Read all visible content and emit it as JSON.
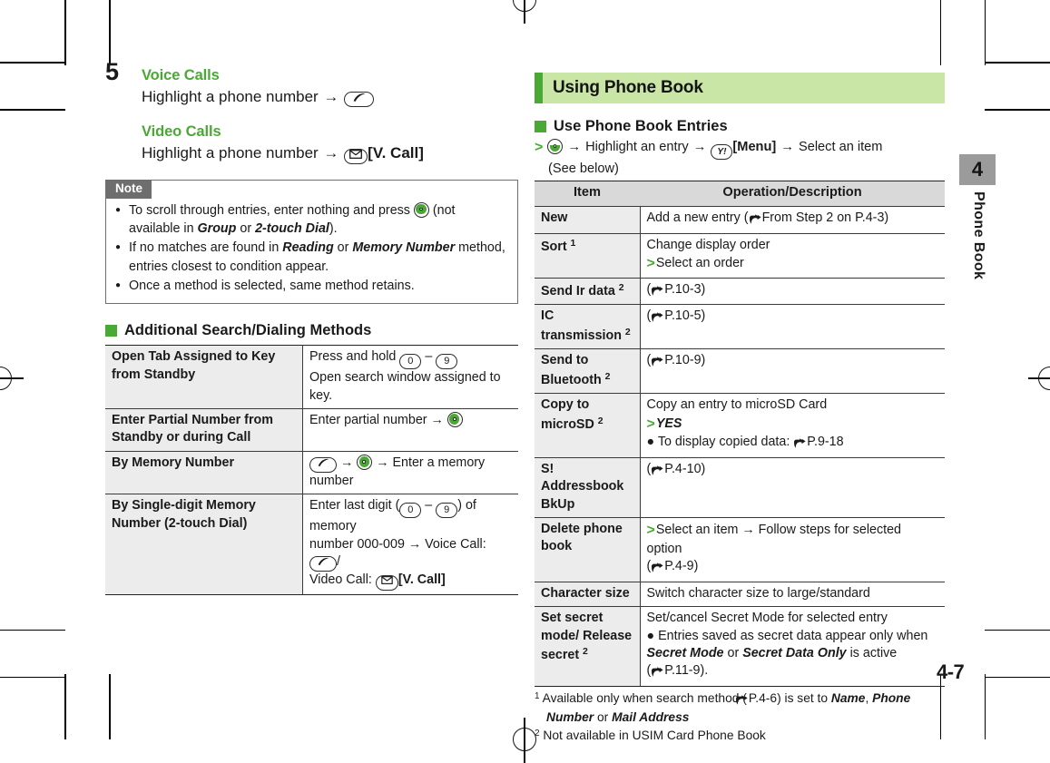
{
  "page": {
    "number": "4-7",
    "chapter_number": "4",
    "chapter_label": "Phone Book",
    "accent_green": "#4aa935",
    "banner_bg": "#c9e6a6",
    "tab_bg": "#9b9b9b"
  },
  "left": {
    "step": {
      "number": "5",
      "voice": {
        "heading": "Voice Calls",
        "text_before": "Highlight a phone number",
        "arrow": "→",
        "key_icon": "call-key-icon"
      },
      "video": {
        "heading": "Video Calls",
        "text_before": "Highlight a phone number",
        "arrow": "→",
        "key_icon": "mail-key-icon",
        "key_label": "[V. Call]"
      }
    },
    "note": {
      "tab_label": "Note",
      "items": [
        {
          "parts": [
            {
              "t": "To scroll through entries, enter nothing and press ",
              "s": "n"
            },
            {
              "t": "",
              "s": "navkey"
            },
            {
              "t": " (not available in ",
              "s": "n"
            },
            {
              "t": "Group",
              "s": "bi"
            },
            {
              "t": " or ",
              "s": "n"
            },
            {
              "t": "2-touch Dial",
              "s": "bi"
            },
            {
              "t": ").",
              "s": "n"
            }
          ]
        },
        {
          "parts": [
            {
              "t": "If no matches are found in ",
              "s": "n"
            },
            {
              "t": "Reading",
              "s": "bi"
            },
            {
              "t": " or ",
              "s": "n"
            },
            {
              "t": "Memory Number",
              "s": "bi"
            },
            {
              "t": " method, entries closest to condition appear.",
              "s": "n"
            }
          ]
        },
        {
          "parts": [
            {
              "t": "Once a method is selected, same method retains.",
              "s": "n"
            }
          ]
        }
      ]
    },
    "additional": {
      "heading": "Additional Search/Dialing Methods",
      "rows": [
        {
          "item": "Open Tab Assigned to Key from Standby",
          "desc_lines": [
            [
              {
                "t": "Press and hold ",
                "s": "n"
              },
              {
                "t": "0",
                "s": "key"
              },
              {
                "t": " – ",
                "s": "n"
              },
              {
                "t": "9",
                "s": "key"
              }
            ],
            [
              {
                "t": "Open search window assigned to key.",
                "s": "n"
              }
            ]
          ]
        },
        {
          "item": "Enter Partial Number from Standby or during Call",
          "desc_lines": [
            [
              {
                "t": "Enter partial number ",
                "s": "n"
              },
              {
                "t": "→ ",
                "s": "n"
              },
              {
                "t": "",
                "s": "navkey"
              }
            ]
          ]
        },
        {
          "item": "By Memory Number",
          "desc_lines": [
            [
              {
                "t": "",
                "s": "callkey"
              },
              {
                "t": " → ",
                "s": "n"
              },
              {
                "t": "",
                "s": "navkey"
              },
              {
                "t": " → Enter a memory number",
                "s": "n"
              }
            ]
          ]
        },
        {
          "item": "By Single-digit Memory Number (2-touch Dial)",
          "desc_lines": [
            [
              {
                "t": "Enter last digit (",
                "s": "n"
              },
              {
                "t": "0",
                "s": "key"
              },
              {
                "t": " – ",
                "s": "n"
              },
              {
                "t": "9",
                "s": "key"
              },
              {
                "t": ") of memory",
                "s": "n"
              }
            ],
            [
              {
                "t": "number 000-009 → Voice Call: ",
                "s": "n"
              },
              {
                "t": "",
                "s": "callkey"
              },
              {
                "t": "/",
                "s": "n"
              }
            ],
            [
              {
                "t": "Video Call: ",
                "s": "n"
              },
              {
                "t": "",
                "s": "mailkey"
              },
              {
                "t": "[V. Call]",
                "s": "b"
              }
            ]
          ]
        }
      ]
    }
  },
  "right": {
    "banner_title": "Using Phone Book",
    "section_heading": "Use Phone Book Entries",
    "operation_line": {
      "prompt": ">",
      "key1_icon": "phonebook-key-icon",
      "a1": "→",
      "t1": "Highlight an entry",
      "a2": "→",
      "key2_icon": "yahoo-menu-key-icon",
      "key2_label": "[Menu]",
      "a3": "→",
      "t2": "Select an item",
      "sub": "(See below)"
    },
    "table": {
      "headers": [
        "Item",
        "Operation/Description"
      ],
      "rows": [
        {
          "item": "New",
          "item_sup": "",
          "lines": [
            [
              {
                "t": "Add a new entry (",
                "s": "n"
              },
              {
                "t": "",
                "s": "hand"
              },
              {
                "t": "From Step 2 on P.4-3)",
                "s": "n"
              }
            ]
          ]
        },
        {
          "item": "Sort",
          "item_sup": "1",
          "lines": [
            [
              {
                "t": "Change display order",
                "s": "n"
              }
            ],
            [
              {
                "t": ">",
                "s": "gt"
              },
              {
                "t": "Select an order",
                "s": "n"
              }
            ]
          ]
        },
        {
          "item": "Send Ir data",
          "item_sup": "2",
          "lines": [
            [
              {
                "t": "(",
                "s": "n"
              },
              {
                "t": "",
                "s": "hand"
              },
              {
                "t": "P.10-3)",
                "s": "n"
              }
            ]
          ]
        },
        {
          "item": "IC transmission",
          "item_sup": "2",
          "lines": [
            [
              {
                "t": "(",
                "s": "n"
              },
              {
                "t": "",
                "s": "hand"
              },
              {
                "t": "P.10-5)",
                "s": "n"
              }
            ]
          ]
        },
        {
          "item": "Send to Bluetooth",
          "item_sup": "2",
          "lines": [
            [
              {
                "t": "(",
                "s": "n"
              },
              {
                "t": "",
                "s": "hand"
              },
              {
                "t": "P.10-9)",
                "s": "n"
              }
            ]
          ]
        },
        {
          "item": "Copy to microSD",
          "item_sup": "2",
          "lines": [
            [
              {
                "t": "Copy an entry to microSD Card",
                "s": "n"
              }
            ],
            [
              {
                "t": ">",
                "s": "gt"
              },
              {
                "t": "YES",
                "s": "bi"
              }
            ],
            [
              {
                "t": "● To display copied data: ",
                "s": "n"
              },
              {
                "t": "",
                "s": "hand"
              },
              {
                "t": "P.9-18",
                "s": "n"
              }
            ]
          ]
        },
        {
          "item": "S! Addressbook BkUp",
          "item_sup": "",
          "lines": [
            [
              {
                "t": "(",
                "s": "n"
              },
              {
                "t": "",
                "s": "hand"
              },
              {
                "t": "P.4-10)",
                "s": "n"
              }
            ]
          ]
        },
        {
          "item": "Delete phone book",
          "item_sup": "",
          "lines": [
            [
              {
                "t": ">",
                "s": "gt"
              },
              {
                "t": "Select an item → Follow steps for selected option",
                "s": "n"
              }
            ],
            [
              {
                "t": "  (",
                "s": "n"
              },
              {
                "t": "",
                "s": "hand"
              },
              {
                "t": "P.4-9)",
                "s": "n"
              }
            ]
          ]
        },
        {
          "item": "Character size",
          "item_sup": "",
          "lines": [
            [
              {
                "t": "Switch character size to large/standard",
                "s": "n"
              }
            ]
          ]
        },
        {
          "item": "Set secret mode/ Release secret",
          "item_sup": "2",
          "lines": [
            [
              {
                "t": "Set/cancel Secret Mode for selected entry",
                "s": "n"
              }
            ],
            [
              {
                "t": "● Entries saved as secret data appear only when",
                "s": "n"
              }
            ],
            [
              {
                "t": "   ",
                "s": "n"
              },
              {
                "t": "Secret Mode",
                "s": "bi"
              },
              {
                "t": " or ",
                "s": "n"
              },
              {
                "t": "Secret Data Only",
                "s": "bi"
              },
              {
                "t": " is active",
                "s": "n"
              }
            ],
            [
              {
                "t": "   (",
                "s": "n"
              },
              {
                "t": "",
                "s": "hand"
              },
              {
                "t": "P.11-9).",
                "s": "n"
              }
            ]
          ]
        }
      ]
    },
    "footnotes": [
      {
        "marker": "1",
        "parts": [
          {
            "t": "Available only when search method (",
            "s": "n"
          },
          {
            "t": "",
            "s": "hand"
          },
          {
            "t": "P.4-6) is set to ",
            "s": "n"
          },
          {
            "t": "Name",
            "s": "bi"
          },
          {
            "t": ", ",
            "s": "n"
          },
          {
            "t": "Phone Number",
            "s": "bi"
          },
          {
            "t": " or ",
            "s": "n"
          },
          {
            "t": "Mail Address",
            "s": "bi"
          }
        ]
      },
      {
        "marker": "2",
        "parts": [
          {
            "t": "Not available in USIM Card Phone Book",
            "s": "n"
          }
        ]
      }
    ]
  }
}
